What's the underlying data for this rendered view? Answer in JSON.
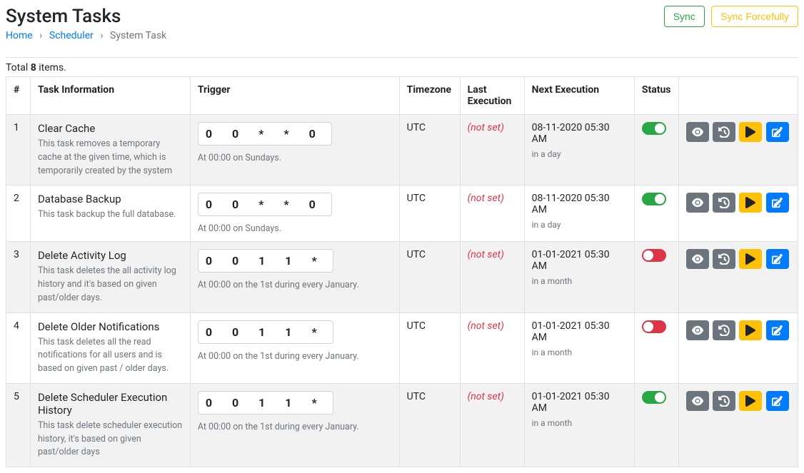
{
  "header": {
    "title": "System Tasks",
    "sync_label": "Sync",
    "sync_force_label": "Sync Forcefully"
  },
  "breadcrumb": {
    "home": "Home",
    "scheduler": "Scheduler",
    "current": "System Task"
  },
  "totals": {
    "prefix": "Total ",
    "count": "8",
    "suffix": " items."
  },
  "columns": {
    "num": "#",
    "task": "Task Information",
    "trigger": "Trigger",
    "timezone": "Timezone",
    "last": "Last Execution",
    "next": "Next Execution",
    "status": "Status"
  },
  "not_set": "(not set)",
  "rows": [
    {
      "num": "1",
      "name": "Clear Cache",
      "desc": "This task removes a temporary cache at the given time, which is temporarily created by the system",
      "cron": "0  0  *  *  0",
      "cron_desc": "At 00:00 on Sundays.",
      "timezone": "UTC",
      "next_time": "08-11-2020 05:30 AM",
      "next_rel": "in a day",
      "status": "on"
    },
    {
      "num": "2",
      "name": "Database Backup",
      "desc": "This task backup the full database.",
      "cron": "0  0  *  *  0",
      "cron_desc": "At 00:00 on Sundays.",
      "timezone": "UTC",
      "next_time": "08-11-2020 05:30 AM",
      "next_rel": "in a day",
      "status": "on"
    },
    {
      "num": "3",
      "name": "Delete Activity Log",
      "desc": "This task deletes the all activity log history and it's based on given past/older days.",
      "cron": "0  0  1  1  *",
      "cron_desc": "At 00:00 on the 1st during every January.",
      "timezone": "UTC",
      "next_time": "01-01-2021 05:30 AM",
      "next_rel": "in a month",
      "status": "off"
    },
    {
      "num": "4",
      "name": "Delete Older Notifications",
      "desc": "This task deletes all the read notifications for all users and is based on given past / older days.",
      "cron": "0  0  1  1  *",
      "cron_desc": "At 00:00 on the 1st during every January.",
      "timezone": "UTC",
      "next_time": "01-01-2021 05:30 AM",
      "next_rel": "in a month",
      "status": "off"
    },
    {
      "num": "5",
      "name": "Delete Scheduler Execution History",
      "desc": "This task delete scheduler execution history, it's based on given past/older days",
      "cron": "0  0  1  1  *",
      "cron_desc": "At 00:00 on the 1st during every January.",
      "timezone": "UTC",
      "next_time": "01-01-2021 05:30 AM",
      "next_rel": "in a month",
      "status": "on"
    }
  ]
}
